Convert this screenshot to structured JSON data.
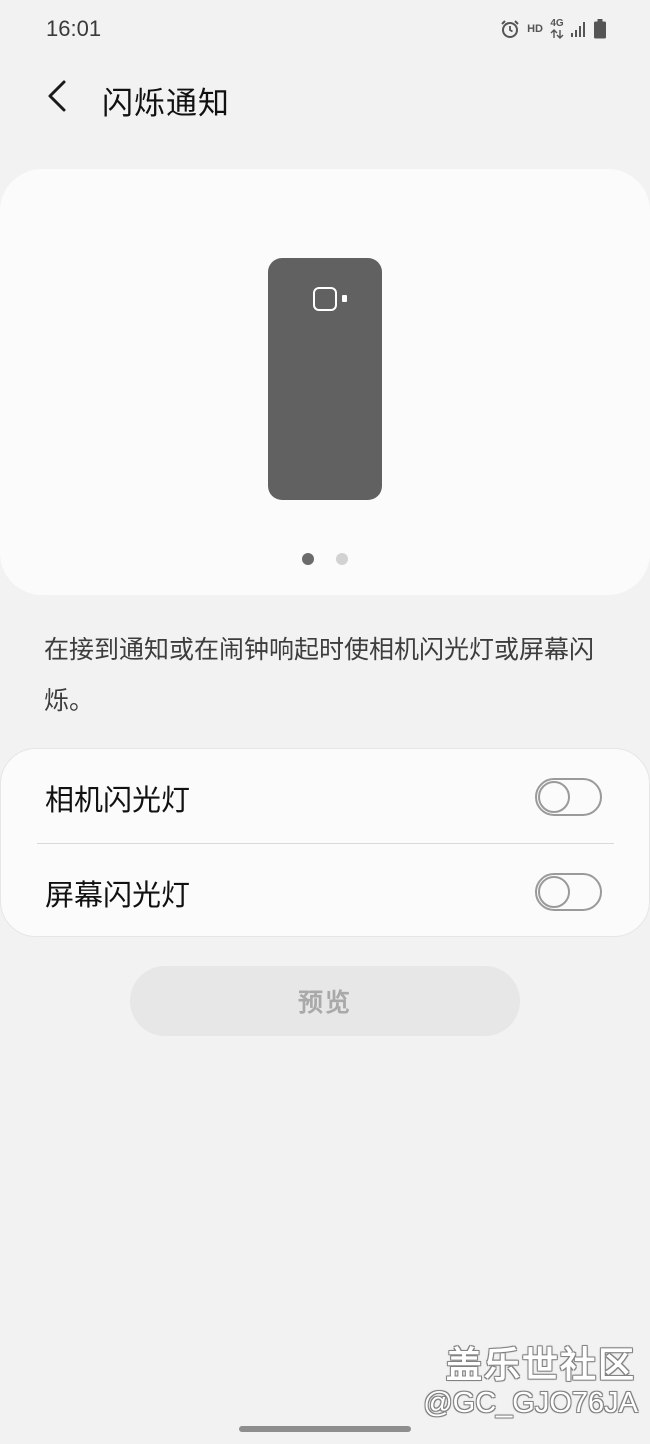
{
  "status_bar": {
    "time": "16:01",
    "hd_label": "HD",
    "network_label": "4G",
    "icons": [
      "alarm-icon",
      "hd-icon",
      "4g-icon",
      "signal-icon",
      "battery-icon"
    ]
  },
  "header": {
    "back_icon": "chevron-left-icon",
    "title": "闪烁通知"
  },
  "illustration": {
    "page_count": 2,
    "active_page": 1
  },
  "description": "在接到通知或在闹钟响起时使相机闪光灯或屏幕闪烁。",
  "settings": [
    {
      "label": "相机闪光灯",
      "enabled": false
    },
    {
      "label": "屏幕闪光灯",
      "enabled": false
    }
  ],
  "preview_button": {
    "label": "预览",
    "enabled": false
  },
  "watermark": {
    "brand": "盖乐世社区",
    "handle": "@GC_GJO76JA"
  },
  "colors": {
    "background": "#f2f2f2",
    "card": "#fbfbfb",
    "phone_illustration": "#616161",
    "toggle_off": "#9a9a9a",
    "disabled_text": "#a9a9a9"
  }
}
